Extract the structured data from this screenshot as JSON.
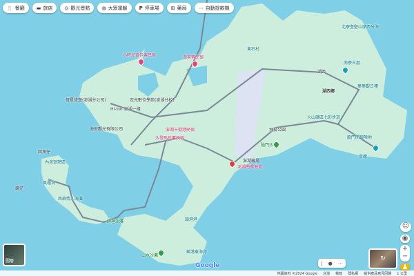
{
  "chips": [
    {
      "icon": "restaurant-icon",
      "glyph": "🍴",
      "label": "餐廳"
    },
    {
      "icon": "hotel-icon",
      "glyph": "▬",
      "label": "旅店"
    },
    {
      "icon": "camera-icon",
      "glyph": "◎",
      "label": "觀光景點"
    },
    {
      "icon": "transit-icon",
      "glyph": "◍",
      "label": "大眾運輸"
    },
    {
      "icon": "parking-icon",
      "glyph": "P",
      "label": "停車場"
    },
    {
      "icon": "pharmacy-icon",
      "glyph": "⊞",
      "label": "藥局"
    },
    {
      "icon": "atm-icon",
      "glyph": "⋯",
      "label": "自動提款機"
    }
  ],
  "labels": {
    "airport": "澎湖機場",
    "huxi": "湖西",
    "huxi_township": "湖西鄉",
    "nanliao": "南寮古厝",
    "beiliao": "北寮奎壁山摩西分海",
    "guoye": "菓葉觀日樓",
    "lintou": "林投公園",
    "aimen": "隘門沙灘",
    "longmen": "龍門閉鎖陣地",
    "qingluo": "青螺",
    "hill": "火山礦區七彩步道",
    "marker": "澎湖南環海堤",
    "zhiguang": "志光數位學苑(澎湖分校)",
    "hiinn": "Hi-Inn 澎湖一棧",
    "hotel1": "澎湖十號港民宿",
    "hotel2": "沙發馬鈴薯民宿",
    "haian": "海安觀光有限公司",
    "company": "恆星旅遊(澎湖分公司)",
    "bnb1": "小時光背包客民宿",
    "bnb2": "海芙蓉民宿",
    "dongshi": "東石村",
    "sijiao": "四角仔",
    "neian": "內垵遊憩區",
    "fenggui": "風櫃洞",
    "lover": "西嶼情人海灘",
    "shili": "蒔裡沙灘",
    "shanshui": "山水沙灘",
    "suogang": "鎖港港",
    "reef": "鎖港東海岸",
    "jingzi": "鏡仔"
  },
  "layers_label": "圖層",
  "footer": {
    "data": "地圖資料 ©2024 Google",
    "region": "台灣",
    "terms": "條款",
    "privacy": "隱私權",
    "feedback": "提供產品意見回饋",
    "scale": "1 公里"
  },
  "colors": {
    "water": "#7fd0e6",
    "land": "#cdeedd",
    "road": "#7a8896",
    "hotel": "#e8437a",
    "poi": "#13a3b5",
    "marker": "#e53935"
  }
}
